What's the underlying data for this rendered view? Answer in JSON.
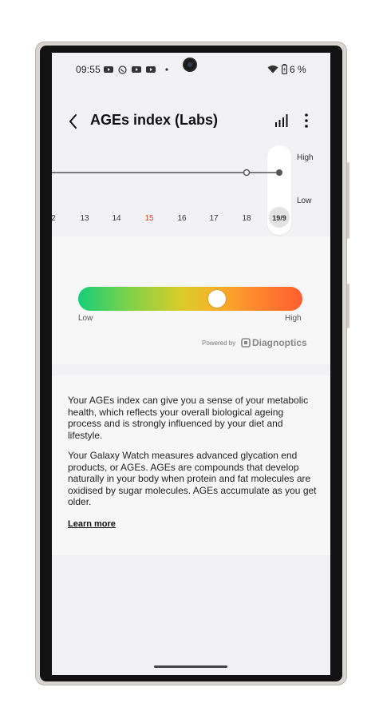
{
  "status_bar": {
    "time": "09:55",
    "icons": [
      "youtube-icon",
      "whatsapp-icon",
      "youtube-icon",
      "youtube-icon",
      "dot-icon",
      "wifi-icon",
      "battery-icon"
    ],
    "battery": "6 %"
  },
  "header": {
    "back_icon": "chevron-left-icon",
    "title": "AGEs index (Labs)",
    "chart_icon": "bar-chart-icon",
    "more_icon": "more-vertical-icon"
  },
  "graph": {
    "high_label": "High",
    "low_label": "Low",
    "days": [
      "2",
      "13",
      "14",
      "15",
      "16",
      "17",
      "18"
    ],
    "highlight_day": "15",
    "selected_day": "19/9"
  },
  "gauge": {
    "low_label": "Low",
    "high_label": "High",
    "value": 0.62,
    "powered_by": "Powered by",
    "brand": "Diagnoptics",
    "colors": [
      "#16cf78",
      "#d6cd2a",
      "#ff5e2e"
    ]
  },
  "description": {
    "paragraph1": "Your AGEs index can give you a sense of your metabolic health, which reflects your overall biological ageing process and is strongly influenced by your diet and lifestyle.",
    "paragraph2": "Your Galaxy Watch measures advanced glycation end products, or AGEs. AGEs are compounds that develop naturally in your body when protein and fat molecules are oxidised by sugar molecules. AGEs accumulate as you get older.",
    "learn_more": "Learn more"
  }
}
